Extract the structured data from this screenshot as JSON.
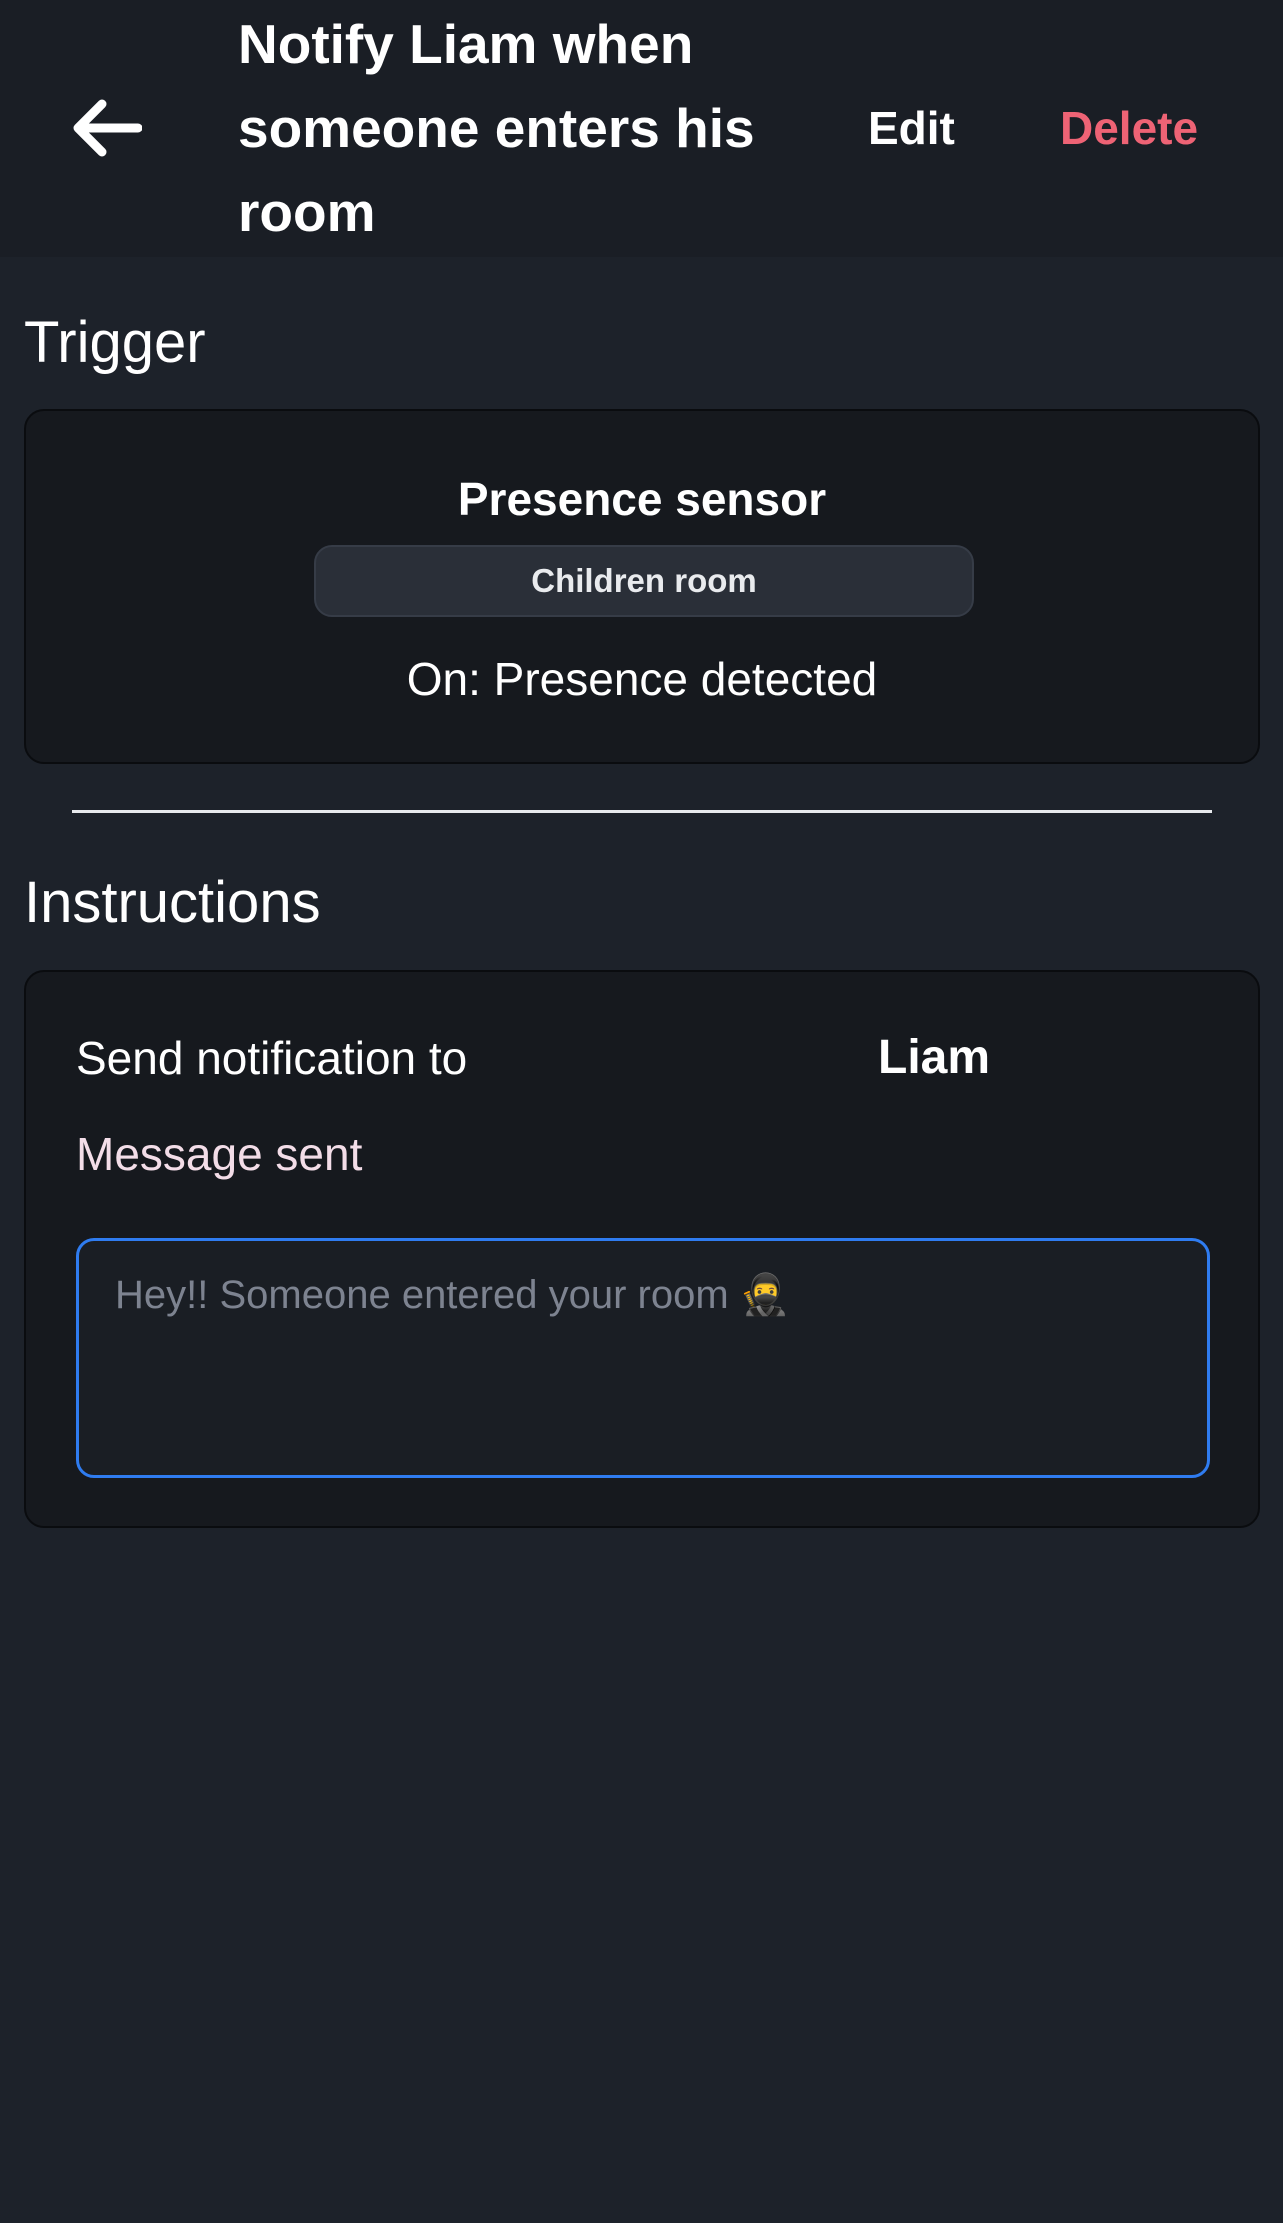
{
  "header": {
    "back_icon": "arrow-left-icon",
    "title": "Notify Liam when someone enters his room",
    "edit_label": "Edit",
    "delete_label": "Delete",
    "delete_color": "#ee6375"
  },
  "trigger": {
    "heading": "Trigger",
    "device_name": "Presence sensor",
    "room": "Children room",
    "state": "On: Presence detected"
  },
  "instructions": {
    "heading": "Instructions",
    "recipient_label": "Send notification to",
    "recipient_value": "Liam",
    "message_label": "Message sent",
    "message_value": "",
    "message_placeholder": "Hey!! Someone entered your room 🥷",
    "input_focus_color": "#2f7cf0"
  }
}
